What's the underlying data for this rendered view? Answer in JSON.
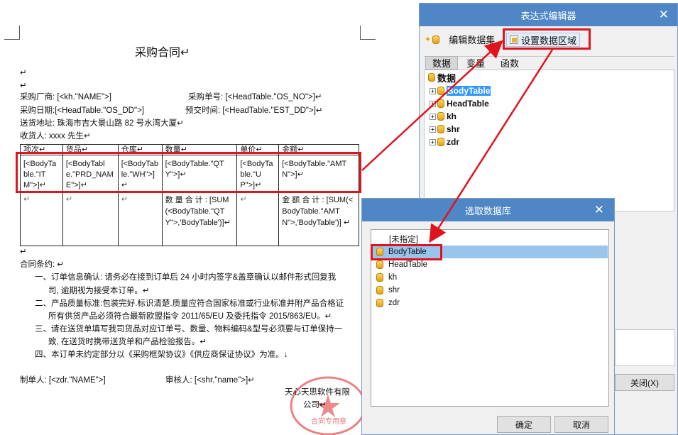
{
  "document": {
    "title": "采购合同↵",
    "para_marks": [
      "↵",
      "↵"
    ],
    "fields": {
      "supplier": "采购厂商: [<kh.\"NAME\">]",
      "order_no": "采购单号: [<HeadTable.\"OS_NO\">]↵",
      "order_date": "采购日期:[<HeadTable.\"OS_DD\">]",
      "delivery_time": "预交时间: [<HeadTable.\"EST_DD\">]↵",
      "address": "送货地址: 珠海市吉大景山路 82 号水湾大厦↵",
      "receiver": "收货人: xxxx 先生↵"
    },
    "table": {
      "headers": [
        "项次↵",
        "货品↵",
        "仓库↵",
        "数量↵",
        "单价↵",
        "金额↵"
      ],
      "row1": [
        "[<BodyTable.\"ITM\">]↵",
        "[<BodyTable.\"PRD_NAME\">]↵",
        "[<BodyTable.\"WH\">]↵",
        "[<BodyTable.\"QTY\">]↵",
        "[<BodyTable.\"UP\">]↵",
        "[<BodyTable.\"AMTN\">]↵"
      ],
      "row2": [
        "↵",
        "↵",
        "↵",
        "数 量 合 计 : [SUM(<BodyTable.\"QTY\">,'BodyTable')]↵",
        "↵",
        "金 额 合 计 : [SUM(<BodyTable.\"AMTN\">,'BodyTable')] ↵"
      ]
    },
    "terms_title": "合同条约: ↵",
    "terms": [
      "一、订单信息确认: 请务必在接到订单后 24 小时内签字&盖章确认以邮件形式回复我",
      "司, 逾期视为接受本订单。↵",
      "二、产品质量标准:包装完好.标识清楚.质量应符合国家标准或行业标准并附产品合格证",
      "所有供货产品必须符合最新欧盟指令 2011/65/EU 及委托指令 2015/863/EU。↵",
      "三、请在送货单填写我司货品对应订单号、数量、物料编码&型号必须要与订单保持一",
      "致, 在送货时携带送货单和产品检验报告。↵",
      "四、本订单未约定部分以《采购框架协议》《供应商保证协议》为准。↓"
    ],
    "maker": "制单人: [<zdr.\"NAME\">]",
    "reviewer": "审核人: [<shr.\"name\">]↵",
    "company": "天心天思软件有限",
    "company2": "公司↵",
    "seal_text": "合同专用章"
  },
  "expr_editor": {
    "title": "表达式编辑器",
    "toolbar": {
      "edit_dataset": "编辑数据集",
      "set_region": "设置数据区域"
    },
    "tabs": [
      "数据",
      "变量",
      "函数"
    ],
    "tree_root": "数据",
    "tree_items": [
      "BodyTable",
      "HeadTable",
      "kh",
      "shr",
      "zdr"
    ],
    "close_label": "关闭(X)"
  },
  "db_picker": {
    "title": "选取数据库",
    "items": [
      "[未指定]",
      "BodyTable",
      "HeadTable",
      "kh",
      "shr",
      "zdr"
    ],
    "selected": "BodyTable",
    "ok_label": "确定",
    "cancel_label": "取消"
  },
  "colors": {
    "accent": "#4f86c6",
    "highlight": "#e0141e",
    "selection": "#99c5ec"
  }
}
